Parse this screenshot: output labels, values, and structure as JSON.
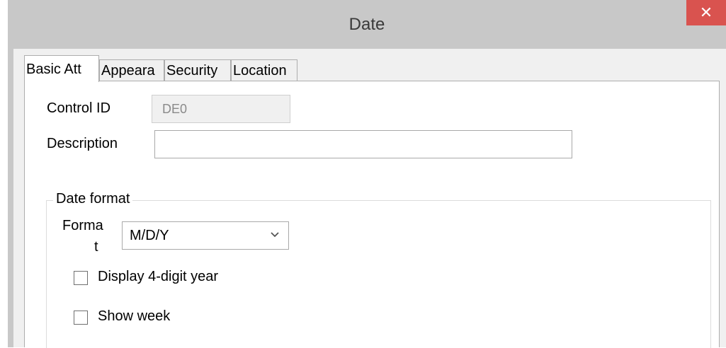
{
  "window": {
    "title": "Date",
    "close_glyph": "✕",
    "close_color": "#d9534f"
  },
  "tabs": [
    {
      "label": "Basic Att",
      "active": true
    },
    {
      "label": "Appeara",
      "active": false
    },
    {
      "label": "Security",
      "active": false
    },
    {
      "label": "Location",
      "active": false
    }
  ],
  "basic": {
    "control_id_label": "Control ID",
    "control_id_value": "DE0",
    "description_label": "Description",
    "description_value": ""
  },
  "date_format": {
    "group_label": "Date format",
    "format_label_line1": "Forma",
    "format_label_line2": "t",
    "format_value": "M/D/Y",
    "display_4digit_label": "Display 4-digit year",
    "display_4digit_checked": false,
    "show_week_label": "Show week",
    "show_week_checked": false
  }
}
